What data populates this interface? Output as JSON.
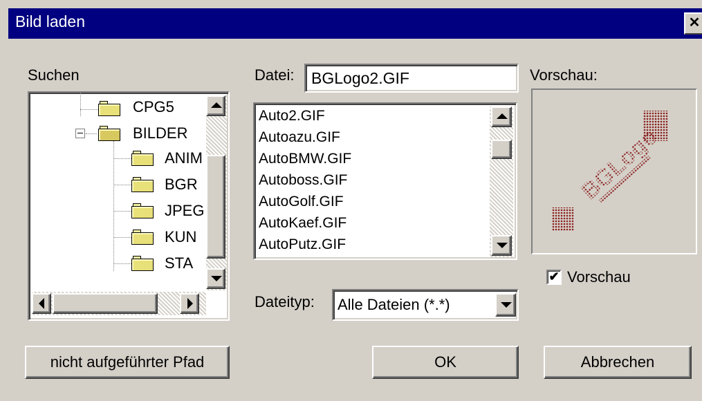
{
  "window": {
    "title": "Bild laden",
    "close_glyph": "✕"
  },
  "search": {
    "label": "Suchen",
    "tree": [
      {
        "label": "CPG5",
        "icon": "folder-icon"
      },
      {
        "label": "BILDER",
        "icon": "open-folder-icon",
        "expanded": true
      },
      {
        "label": "ANIM",
        "icon": "folder-icon"
      },
      {
        "label": "BGR",
        "icon": "folder-icon"
      },
      {
        "label": "JPEG",
        "icon": "folder-icon"
      },
      {
        "label": "KUN",
        "icon": "folder-icon"
      },
      {
        "label": "STA",
        "icon": "folder-icon"
      }
    ]
  },
  "file": {
    "label": "Datei:",
    "value": "BGLogo2.GIF",
    "list": [
      "Auto2.GIF",
      "Autoazu.GIF",
      "AutoBMW.GIF",
      "Autoboss.GIF",
      "AutoGolf.GIF",
      "AutoKaef.GIF",
      "AutoPutz.GIF"
    ]
  },
  "filetype": {
    "label": "Dateityp:",
    "selected": "Alle Dateien (*.*)"
  },
  "preview": {
    "label": "Vorschau:",
    "checkbox_label": "Vorschau",
    "checked": true,
    "check_glyph": "✔",
    "image_text": "BGLogo"
  },
  "buttons": {
    "unlisted_path": "nicht aufgeführter Pfad",
    "ok": "OK",
    "cancel": "Abbrechen"
  },
  "colors": {
    "titlebar": "#000080",
    "face": "#d4d0c8",
    "preview_ink": "#8b2020"
  }
}
